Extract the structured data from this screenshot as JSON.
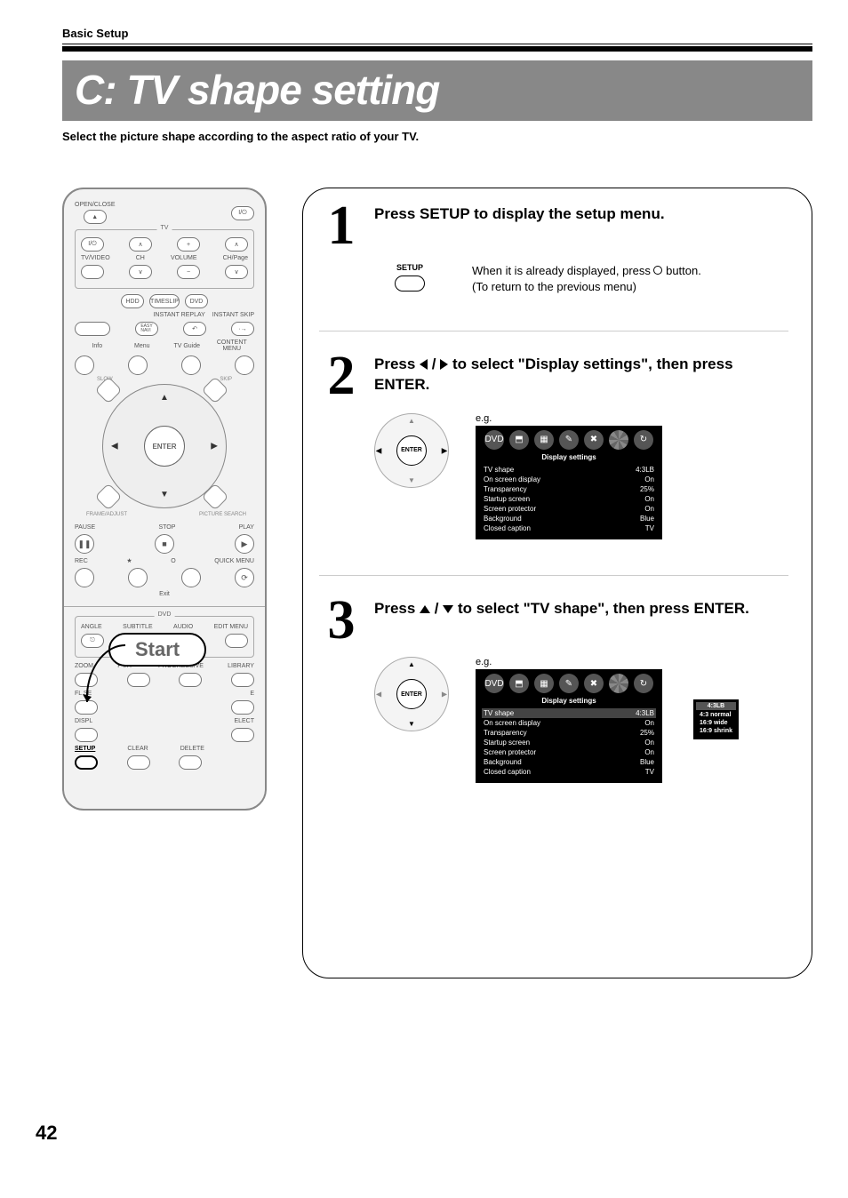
{
  "header": {
    "section": "Basic Setup",
    "title": "C: TV shape setting",
    "intro": "Select the picture shape according to the aspect ratio of your TV."
  },
  "remote": {
    "open_close": "OPEN/CLOSE",
    "power": "I/⏻",
    "tv_group": "TV",
    "tv_video": "TV/VIDEO",
    "ch": "CH",
    "volume": "VOLUME",
    "ch_page": "CH/Page",
    "hdd": "HDD",
    "timeslip": "TIMESLIP",
    "dvd": "DVD",
    "instant_replay": "INSTANT REPLAY",
    "instant_skip": "INSTANT SKIP",
    "easy_navi": "EASY\nNAVI",
    "menu": "Menu",
    "tv_guide": "TV Guide",
    "info": "Info",
    "content_menu": "CONTENT MENU",
    "slow": "SLOW",
    "skip": "SKIP",
    "frame_adjust": "FRAME/ADJUST",
    "picture_search": "PICTURE SEARCH",
    "enter": "ENTER",
    "pause": "PAUSE",
    "stop": "STOP",
    "play": "PLAY",
    "rec": "REC",
    "star": "★",
    "circle": "O",
    "quick_menu": "QUICK MENU",
    "exit": "Exit",
    "dvd_group": "DVD",
    "angle": "ANGLE",
    "subtitle": "SUBTITLE",
    "audio": "AUDIO",
    "edit_menu": "EDIT MENU",
    "zoom": "ZOOM",
    "pinp": "P in P",
    "progressive": "PROGRESSIVE",
    "library": "LIBRARY",
    "fl_select": "FL SELECT",
    "mode": "MODE",
    "display": "DISPLAY",
    "input_select": "INPUT SELECT",
    "setup": "SETUP",
    "clear": "CLEAR",
    "delete": "DELETE",
    "start_callout": "Start"
  },
  "steps": {
    "s1": {
      "num": "1",
      "head": "Press SETUP to display the setup menu.",
      "btn_label": "SETUP",
      "sub1": "When it is already displayed, press ",
      "sub1b": " button.",
      "sub2": "(To return to the previous menu)"
    },
    "s2": {
      "num": "2",
      "head_a": "Press ",
      "head_b": " / ",
      "head_c": " to select \"Display settings\", then press ENTER.",
      "enter": "ENTER",
      "eg": "e.g."
    },
    "s3": {
      "num": "3",
      "head_a": "Press ",
      "head_b": " / ",
      "head_c": " to select \"TV shape\", then press ENTER.",
      "enter": "ENTER",
      "eg": "e.g."
    },
    "osd": {
      "title": "Display settings",
      "rows": [
        {
          "k": "TV shape",
          "v": "4:3LB"
        },
        {
          "k": "On screen display",
          "v": "On"
        },
        {
          "k": "Transparency",
          "v": "25%"
        },
        {
          "k": "Startup screen",
          "v": "On"
        },
        {
          "k": "Screen protector",
          "v": "On"
        },
        {
          "k": "Background",
          "v": "Blue"
        },
        {
          "k": "Closed caption",
          "v": "TV"
        }
      ],
      "options": [
        "4:3LB",
        "4:3 normal",
        "16:9 wide",
        "16:9 shrink"
      ]
    }
  },
  "page_number": "42"
}
